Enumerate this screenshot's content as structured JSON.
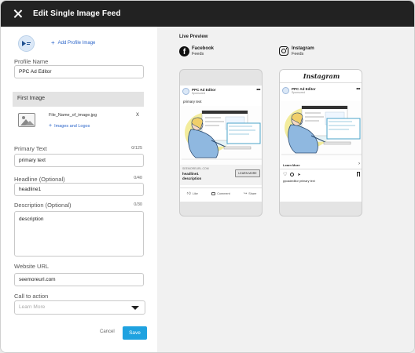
{
  "window": {
    "title": "Edit Single Image Feed"
  },
  "profile": {
    "avatar_text": "PPC Ad Editor",
    "add_label": "Add Profile Image",
    "name_label": "Profile Name",
    "name_value": "PPC Ad Editor"
  },
  "first_image": {
    "section_label": "First Image",
    "filename": "File_Name_of_image.jpg",
    "remove_label": "X",
    "add_label": "Images and Logos"
  },
  "primary_text": {
    "label": "Primary Text",
    "counter": "0/125",
    "value": "primary text"
  },
  "headline": {
    "label": "Headline (Optional)",
    "counter": "0/40",
    "value": "headline1"
  },
  "description": {
    "label": "Description (Optional)",
    "counter": "0/30",
    "value": "description"
  },
  "website": {
    "label": "Website URL",
    "value": "seemoreurl.com"
  },
  "cta": {
    "label": "Call to action",
    "placeholder": "Learn More"
  },
  "actions": {
    "cancel": "Cancel",
    "save": "Save"
  },
  "preview": {
    "heading": "Live Preview",
    "facebook": {
      "name": "Facebook",
      "sub": "Feeds",
      "page_name": "PPC Ad Editor",
      "sponsored": "Sponsored",
      "primary_text": "primary text",
      "url": "SEEMOREURL.COM",
      "headline": "headline1",
      "description": "description",
      "cta": "LEARN MORE",
      "actions": [
        "Like",
        "Comment",
        "Share"
      ]
    },
    "instagram": {
      "name": "Instagram",
      "sub": "Feeds",
      "wordmark": "Instagram",
      "page_name": "PPC Ad Editor",
      "sponsored": "Sponsored",
      "cta": "Learn More",
      "caption": "ppcadeditor primary text"
    }
  },
  "colors": {
    "accent": "#1fa2e0",
    "link": "#2a64c9",
    "topbar": "#222222"
  }
}
